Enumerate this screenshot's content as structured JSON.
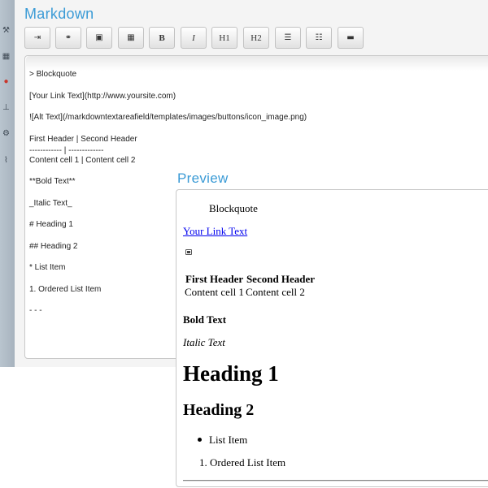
{
  "editor": {
    "title": "Markdown",
    "toolbar": [
      {
        "name": "blockquote-button",
        "label": "",
        "icon": "blockquote-icon",
        "glyph": "⇥"
      },
      {
        "name": "link-button",
        "label": "",
        "icon": "link-icon",
        "glyph": "⚭"
      },
      {
        "name": "image-button",
        "label": "",
        "icon": "image-icon",
        "glyph": "▣"
      },
      {
        "name": "table-button",
        "label": "",
        "icon": "table-icon",
        "glyph": "▦"
      },
      {
        "name": "bold-button",
        "label": "B",
        "icon": "bold-icon",
        "glyph": ""
      },
      {
        "name": "italic-button",
        "label": "I",
        "icon": "italic-icon",
        "glyph": ""
      },
      {
        "name": "h1-button",
        "label": "H1",
        "icon": "heading1-icon",
        "glyph": ""
      },
      {
        "name": "h2-button",
        "label": "H2",
        "icon": "heading2-icon",
        "glyph": ""
      },
      {
        "name": "bullet-list-button",
        "label": "",
        "icon": "bullet-list-icon",
        "glyph": "☰"
      },
      {
        "name": "ordered-list-button",
        "label": "",
        "icon": "ordered-list-icon",
        "glyph": "☷"
      },
      {
        "name": "hr-button",
        "label": "",
        "icon": "horizontal-rule-icon",
        "glyph": "▬"
      }
    ],
    "source_lines": [
      "> Blockquote",
      "[Your Link Text](http://www.yoursite.com)",
      "![Alt Text](/markdowntextareafield/templates/images/buttons/icon_image.png)",
      "First Header | Second Header",
      "------------ | -------------",
      "Content cell 1 | Content cell 2",
      "**Bold Text**",
      "_Italic Text_",
      "# Heading 1",
      "## Heading 2",
      "* List Item",
      "1. Ordered List Item",
      "- - -"
    ]
  },
  "preview": {
    "title": "Preview",
    "blockquote": "Blockquote",
    "link_text": "Your Link Text",
    "table": {
      "headers": [
        "First Header",
        "Second Header"
      ],
      "rows": [
        [
          "Content cell 1",
          "Content cell 2"
        ]
      ]
    },
    "bold_text": "Bold Text",
    "italic_text": "Italic Text",
    "heading1": "Heading 1",
    "heading2": "Heading 2",
    "list_item": "List Item",
    "ordered_item": "1. Ordered List Item"
  },
  "colors": {
    "accent": "#3b9bd6",
    "link": "#0000ee",
    "sidebar": "#b0bcc7"
  },
  "sidebar_icons": [
    "tool-icon",
    "grid-icon",
    "globe-icon",
    "tree-icon",
    "gear-icon",
    "pin-icon"
  ]
}
